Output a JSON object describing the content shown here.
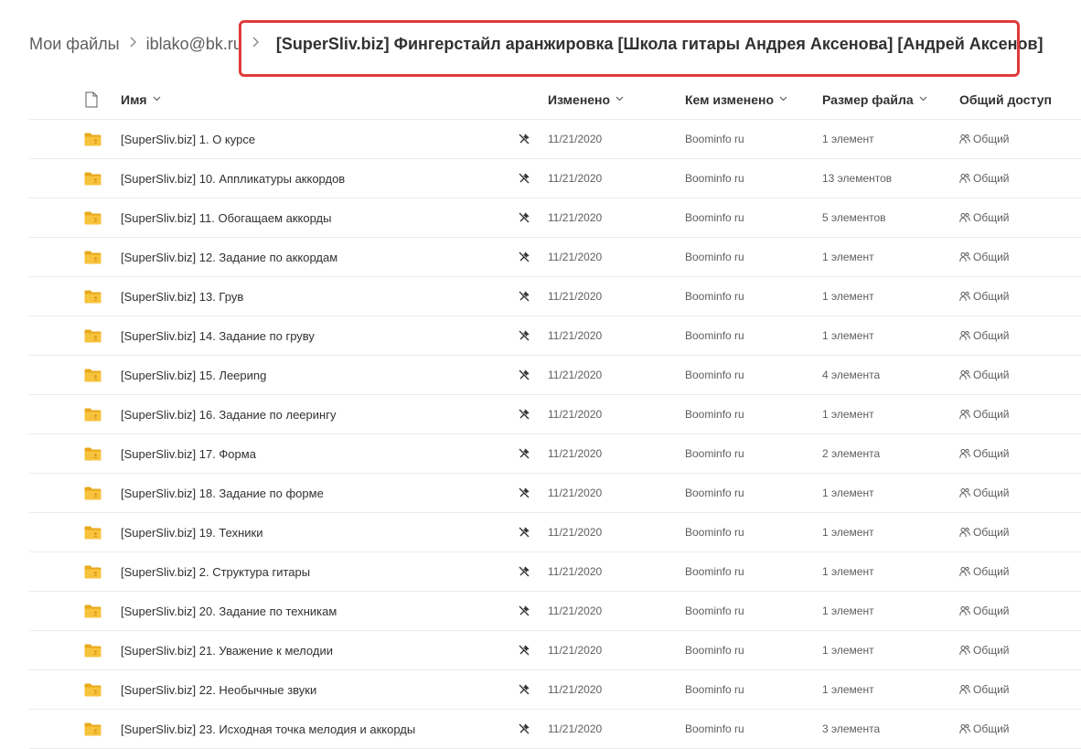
{
  "breadcrumb": {
    "root": "Мои файлы",
    "account": "iblako@bk.ru",
    "current": "[SuperSliv.biz] Фингерстайл аранжировка [Школа гитары Андрея Аксенова] [Андрей Аксенов]"
  },
  "columns": {
    "name": "Имя",
    "modified": "Изменено",
    "modified_by": "Кем изменено",
    "size": "Размер файла",
    "sharing": "Общий доступ"
  },
  "colors": {
    "highlight": "#e03b3b",
    "folder": "#f8c33c"
  },
  "icons": {
    "file_type": "document-icon",
    "folder": "folder-icon",
    "sync": "sync-paused-icon",
    "share": "people-icon",
    "sort": "chevron-down-icon",
    "separator": "chevron-right-icon"
  },
  "rows": [
    {
      "name": "[SuperSliv.biz] 1. О курсе",
      "modified": "11/21/2020",
      "modified_by": "Boominfo ru",
      "size": "1 элемент",
      "sharing": "Общий"
    },
    {
      "name": "[SuperSliv.biz] 10. Аппликатуры аккордов",
      "modified": "11/21/2020",
      "modified_by": "Boominfo ru",
      "size": "13 элементов",
      "sharing": "Общий"
    },
    {
      "name": "[SuperSliv.biz] 11. Обогащаем аккорды",
      "modified": "11/21/2020",
      "modified_by": "Boominfo ru",
      "size": "5 элементов",
      "sharing": "Общий"
    },
    {
      "name": "[SuperSliv.biz] 12. Задание по аккордам",
      "modified": "11/21/2020",
      "modified_by": "Boominfo ru",
      "size": "1 элемент",
      "sharing": "Общий"
    },
    {
      "name": "[SuperSliv.biz] 13. Грув",
      "modified": "11/21/2020",
      "modified_by": "Boominfo ru",
      "size": "1 элемент",
      "sharing": "Общий"
    },
    {
      "name": "[SuperSliv.biz] 14. Задание по груву",
      "modified": "11/21/2020",
      "modified_by": "Boominfo ru",
      "size": "1 элемент",
      "sharing": "Общий"
    },
    {
      "name": "[SuperSliv.biz] 15. Леериng",
      "modified": "11/21/2020",
      "modified_by": "Boominfo ru",
      "size": "4 элемента",
      "sharing": "Общий"
    },
    {
      "name": "[SuperSliv.biz] 16. Задание по леерингу",
      "modified": "11/21/2020",
      "modified_by": "Boominfo ru",
      "size": "1 элемент",
      "sharing": "Общий"
    },
    {
      "name": "[SuperSliv.biz] 17. Форма",
      "modified": "11/21/2020",
      "modified_by": "Boominfo ru",
      "size": "2 элемента",
      "sharing": "Общий"
    },
    {
      "name": "[SuperSliv.biz] 18. Задание по форме",
      "modified": "11/21/2020",
      "modified_by": "Boominfo ru",
      "size": "1 элемент",
      "sharing": "Общий"
    },
    {
      "name": "[SuperSliv.biz] 19. Техники",
      "modified": "11/21/2020",
      "modified_by": "Boominfo ru",
      "size": "1 элемент",
      "sharing": "Общий"
    },
    {
      "name": "[SuperSliv.biz] 2. Структура гитары",
      "modified": "11/21/2020",
      "modified_by": "Boominfo ru",
      "size": "1 элемент",
      "sharing": "Общий"
    },
    {
      "name": "[SuperSliv.biz] 20. Задание по техникам",
      "modified": "11/21/2020",
      "modified_by": "Boominfo ru",
      "size": "1 элемент",
      "sharing": "Общий"
    },
    {
      "name": "[SuperSliv.biz] 21. Уважение к мелодии",
      "modified": "11/21/2020",
      "modified_by": "Boominfo ru",
      "size": "1 элемент",
      "sharing": "Общий"
    },
    {
      "name": "[SuperSliv.biz] 22. Необычные звуки",
      "modified": "11/21/2020",
      "modified_by": "Boominfo ru",
      "size": "1 элемент",
      "sharing": "Общий"
    },
    {
      "name": "[SuperSliv.biz] 23. Исходная точка мелодия и аккорды",
      "modified": "11/21/2020",
      "modified_by": "Boominfo ru",
      "size": "3 элемента",
      "sharing": "Общий"
    }
  ]
}
